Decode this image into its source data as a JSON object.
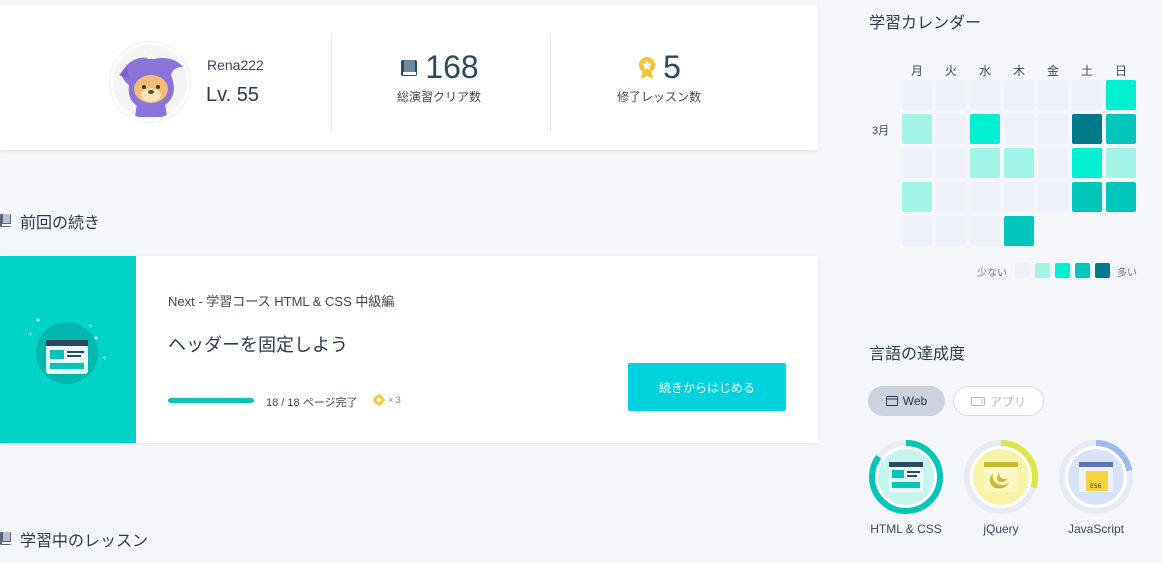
{
  "profile": {
    "username": "Rena222",
    "level": "Lv. 55",
    "stats": [
      {
        "value": "168",
        "label": "総演習クリア数",
        "icon": "book-icon"
      },
      {
        "value": "5",
        "label": "修了レッスン数",
        "icon": "medal-icon"
      }
    ]
  },
  "continue_section": {
    "heading": "前回の続き",
    "course": "Next - 学習コース HTML & CSS 中級編",
    "lesson_title": "ヘッダーを固定しよう",
    "progress_fraction": 1.0,
    "progress_text": "18 / 18 ページ完了",
    "reward_text": "× 3",
    "button_label": "続きからはじめる"
  },
  "lessons_section": {
    "heading": "学習中のレッスン"
  },
  "calendar": {
    "heading": "学習カレンダー",
    "month": "3月",
    "days": [
      "月",
      "火",
      "水",
      "木",
      "金",
      "土",
      "日"
    ],
    "weeks": [
      [
        0,
        0,
        0,
        0,
        0,
        0,
        2
      ],
      [
        1,
        0,
        2,
        0,
        0,
        4,
        3
      ],
      [
        0,
        0,
        1,
        1,
        0,
        2,
        1
      ],
      [
        1,
        0,
        0,
        0,
        0,
        3,
        3
      ],
      [
        0,
        0,
        0,
        3,
        null,
        null,
        null
      ]
    ],
    "legend_less": "少ない",
    "legend_more": "多い",
    "level_colors": [
      "#eef1f7",
      "#a2f5e6",
      "#00f0d2",
      "#00c6bb",
      "#00798a"
    ]
  },
  "languages": {
    "heading": "言語の達成度",
    "tabs": [
      {
        "label": "Web",
        "icon": "browser-icon",
        "active": true
      },
      {
        "label": "アプリ",
        "icon": "phone-icon",
        "active": false
      }
    ],
    "items": [
      {
        "label": "HTML & CSS",
        "progress": 0.85,
        "color": "#00c5b7",
        "bg": "#c6f4ee"
      },
      {
        "label": "jQuery",
        "progress": 0.3,
        "color": "#dfe44a",
        "bg": "#f7f3a8"
      },
      {
        "label": "JavaScript",
        "progress": 0.22,
        "color": "#9eb8f0",
        "bg": "#d8e3fb"
      }
    ]
  }
}
